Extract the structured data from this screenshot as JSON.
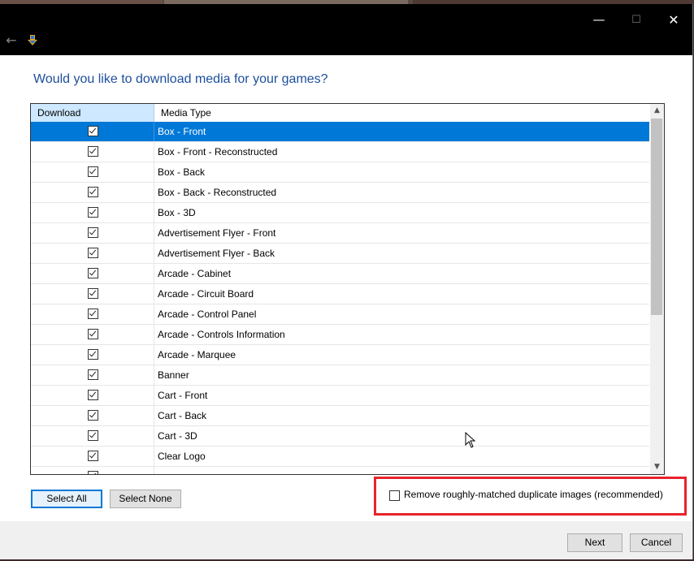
{
  "window": {
    "controls": {
      "minimize": "—",
      "maximize": "☐",
      "close": "✕"
    },
    "back_icon": "←"
  },
  "heading": "Would you like to download media for your games?",
  "grid": {
    "columns": {
      "download": "Download",
      "media_type": "Media Type"
    },
    "rows": [
      {
        "label": "Box - Front",
        "checked": true,
        "selected": true
      },
      {
        "label": "Box - Front - Reconstructed",
        "checked": true
      },
      {
        "label": "Box - Back",
        "checked": true
      },
      {
        "label": "Box - Back - Reconstructed",
        "checked": true
      },
      {
        "label": "Box - 3D",
        "checked": true
      },
      {
        "label": "Advertisement Flyer - Front",
        "checked": true
      },
      {
        "label": "Advertisement Flyer - Back",
        "checked": true
      },
      {
        "label": "Arcade - Cabinet",
        "checked": true
      },
      {
        "label": "Arcade - Circuit Board",
        "checked": true
      },
      {
        "label": "Arcade - Control Panel",
        "checked": true
      },
      {
        "label": "Arcade - Controls Information",
        "checked": true
      },
      {
        "label": "Arcade - Marquee",
        "checked": true
      },
      {
        "label": "Banner",
        "checked": true
      },
      {
        "label": "Cart - Front",
        "checked": true
      },
      {
        "label": "Cart - Back",
        "checked": true
      },
      {
        "label": "Cart - 3D",
        "checked": true
      },
      {
        "label": "Clear Logo",
        "checked": true
      },
      {
        "label": "",
        "checked": true
      }
    ],
    "scroll_up_icon": "▲",
    "scroll_down_icon": "▼"
  },
  "buttons": {
    "select_all": "Select All",
    "select_none": "Select None",
    "next": "Next",
    "cancel": "Cancel"
  },
  "duplicate_option": {
    "label": "Remove roughly-matched duplicate images (recommended)",
    "checked": false
  },
  "colors": {
    "accent": "#0078d7",
    "heading": "#1c4f9c",
    "highlight": "#e8232b",
    "header_selected": "#cde8ff"
  }
}
